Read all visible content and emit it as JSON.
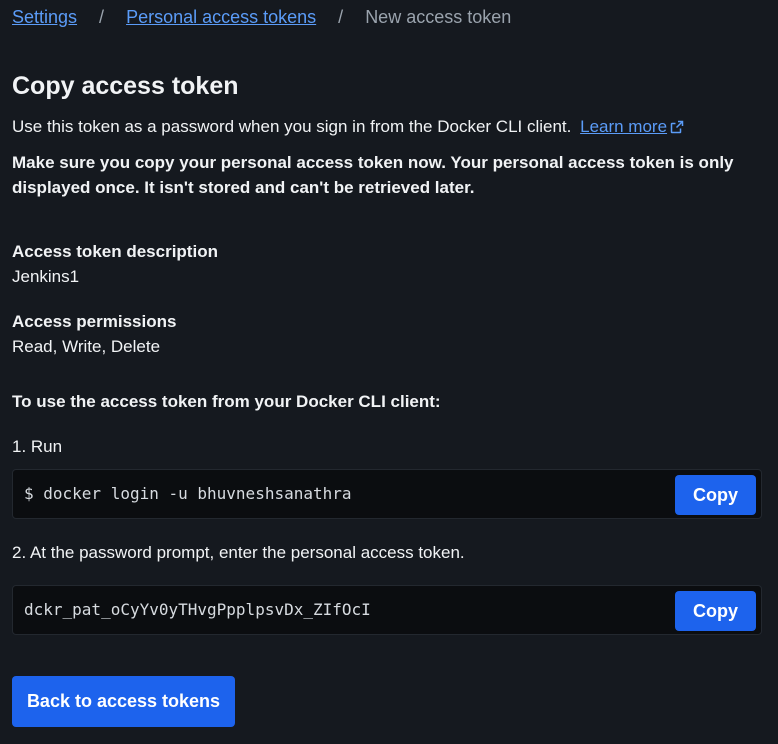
{
  "breadcrumb": {
    "items": [
      "Settings",
      "Personal access tokens"
    ],
    "separator": "/",
    "current": "New access token"
  },
  "heading": "Copy access token",
  "intro": {
    "text": "Use this token as a password when you sign in from the Docker CLI client.",
    "link_label": "Learn more",
    "link_icon": "external-link-icon"
  },
  "warning": "Make sure you copy your personal access token now. Your personal access token is only displayed once. It isn't stored and can't be retrieved later.",
  "token_description": {
    "label": "Access token description",
    "value": "Jenkins1"
  },
  "permissions": {
    "label": "Access permissions",
    "value": "Read, Write, Delete"
  },
  "instructions": {
    "heading": "To use the access token from your Docker CLI client:",
    "step1": "1. Run",
    "command": "$ docker login -u bhuvneshsanathra",
    "step2": "2. At the password prompt, enter the personal access token.",
    "token": "dckr_pat_oCyYv0yTHvgPpplpsvDx_ZIfOcI",
    "copy_label": "Copy"
  },
  "back_button": "Back to access tokens",
  "colors": {
    "background": "#15191f",
    "link": "#5b9cf8",
    "primary_button": "#1d63ed",
    "code_background": "#0b0d10"
  }
}
